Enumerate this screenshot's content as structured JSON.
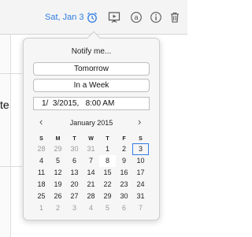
{
  "toolbar": {
    "date_link": "Sat, Jan 3",
    "icons": [
      "clock-icon",
      "present-icon",
      "at-icon",
      "info-icon",
      "trash-icon"
    ],
    "accent_color": "#2f7de1"
  },
  "background": {
    "left_text": "te"
  },
  "popover": {
    "title": "Notify me...",
    "tomorrow_label": "Tomorrow",
    "week_label": "In a Week",
    "datetime_value": "1/  3/2015,   8:00 AM",
    "month_label": "January 2015",
    "prev_label": "‹",
    "next_label": "›",
    "weekdays": [
      "S",
      "M",
      "T",
      "W",
      "T",
      "F",
      "S"
    ],
    "weeks": [
      [
        "28",
        "29",
        "30",
        "31",
        "1",
        "2",
        "3"
      ],
      [
        "4",
        "5",
        "6",
        "7",
        "8",
        "9",
        "10"
      ],
      [
        "11",
        "12",
        "13",
        "14",
        "15",
        "16",
        "17"
      ],
      [
        "18",
        "19",
        "20",
        "21",
        "22",
        "23",
        "24"
      ],
      [
        "25",
        "26",
        "27",
        "28",
        "29",
        "30",
        "31"
      ],
      [
        "1",
        "2",
        "3",
        "4",
        "5",
        "6",
        "7"
      ]
    ],
    "today": "8",
    "selected": "3"
  }
}
